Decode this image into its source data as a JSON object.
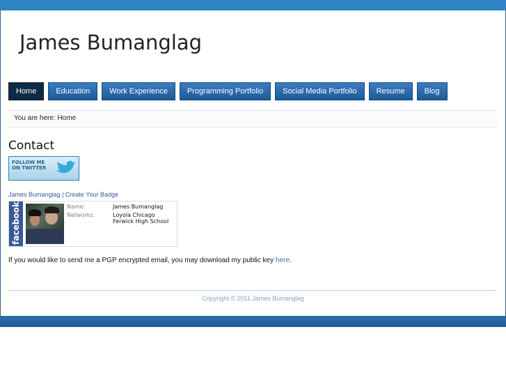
{
  "site": {
    "title": "James Bumanglag"
  },
  "nav": {
    "items": [
      {
        "label": "Home",
        "active": true
      },
      {
        "label": "Education",
        "active": false
      },
      {
        "label": "Work Experience",
        "active": false
      },
      {
        "label": "Programming Portfolio",
        "active": false
      },
      {
        "label": "Social Media Portfolio",
        "active": false
      },
      {
        "label": "Resume",
        "active": false
      },
      {
        "label": "Blog",
        "active": false
      }
    ]
  },
  "breadcrumb": {
    "text": "You are here: Home"
  },
  "content": {
    "title": "Contact",
    "twitter_badge": {
      "line1": "FOLLOW ME",
      "line2": "ON TWITTER"
    },
    "badge_links": {
      "name": "James Bumanglag",
      "separator": "|",
      "create": "Create Your Badge"
    },
    "facebook": {
      "brand": "facebook",
      "name_label": "Name:",
      "name_value": "James Bumanglag",
      "networks_label": "Networks:",
      "networks": [
        "Loyola Chicago",
        "Ferwick High School"
      ]
    },
    "pgp": {
      "text": "If you would like to send me a PGP encrypted email, you may download my public key ",
      "link": "here",
      "end": "."
    }
  },
  "footer": {
    "text": "Copyright © 2011 James Bumanglag"
  },
  "colors": {
    "header_bar": "#2f83c4",
    "nav_bg": "#1f5a98",
    "nav_active": "#0f2a45",
    "facebook_blue": "#3b5998"
  }
}
